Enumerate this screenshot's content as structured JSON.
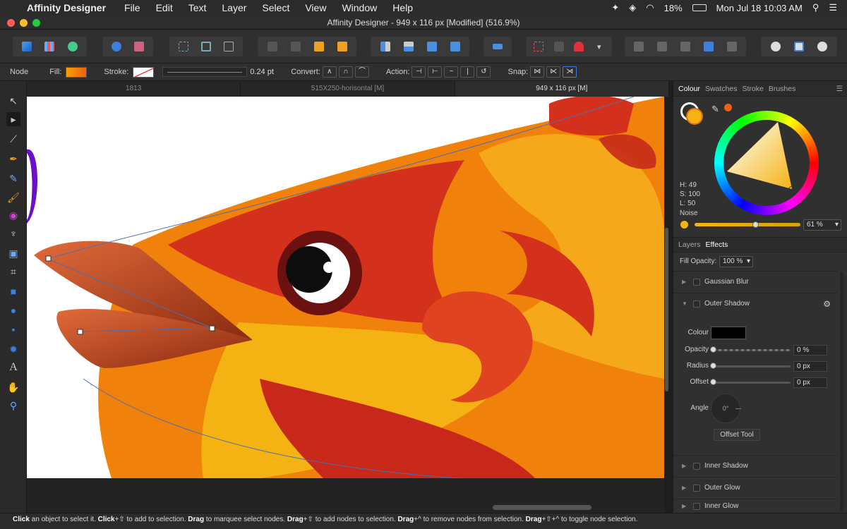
{
  "menubar": {
    "app": "Affinity Designer",
    "items": [
      "File",
      "Edit",
      "Text",
      "Layer",
      "Select",
      "View",
      "Window",
      "Help"
    ],
    "battery": "18%",
    "clock": "Mon Jul 18  10:03 AM"
  },
  "window": {
    "title": "Affinity Designer - 949 x 116 px  [Modified] (516.9%)"
  },
  "context": {
    "mode": "Node",
    "fill_label": "Fill:",
    "stroke_label": "Stroke:",
    "stroke_width": "0.24 pt",
    "convert_label": "Convert:",
    "action_label": "Action:",
    "snap_label": "Snap:"
  },
  "doc_tabs": [
    "1813",
    "515X250-horisontal [M]",
    "949 x 116 px [M]"
  ],
  "colour_panel": {
    "tabs": [
      "Colour",
      "Swatches",
      "Stroke",
      "Brushes"
    ],
    "h": "H: 49",
    "s": "S: 100",
    "l": "L: 50",
    "noise_label": "Noise",
    "noise_value": "61 %"
  },
  "effects_panel": {
    "tabs": [
      "Layers",
      "Effects"
    ],
    "fill_opacity_label": "Fill Opacity:",
    "fill_opacity_value": "100 %",
    "effects": [
      "Gaussian Blur",
      "Outer Shadow",
      "Inner Shadow",
      "Outer Glow",
      "Inner Glow"
    ],
    "outer_shadow": {
      "colour_label": "Colour",
      "opacity_label": "Opacity",
      "opacity_value": "0 %",
      "radius_label": "Radius",
      "radius_value": "0 px",
      "offset_label": "Offset",
      "offset_value": "0 px",
      "angle_label": "Angle",
      "angle_value": "0°",
      "offset_tool": "Offset Tool"
    }
  },
  "status": {
    "parts": [
      [
        "b",
        "Click"
      ],
      " an object to select it. ",
      [
        "b",
        "Click"
      ],
      "+⇧ to add to selection. ",
      [
        "b",
        "Drag"
      ],
      " to marquee select nodes. ",
      [
        "b",
        "Drag"
      ],
      "+⇧ to add nodes to selection. ",
      [
        "b",
        "Drag"
      ],
      "+^ to remove nodes from selection. ",
      [
        "b",
        "Drag"
      ],
      "+⇧+^ to toggle node selection."
    ]
  },
  "colors": {
    "orange": "#f0820c",
    "red": "#d4311c",
    "yellow": "#f5b313",
    "dark_red": "#6b1210",
    "accent_purple": "#6a10c8"
  },
  "icons": [
    "apple-icon",
    "twitter-icon",
    "dropbox-icon",
    "wifi-icon",
    "battery-icon",
    "search-icon",
    "gear-icon",
    "eyedropper-icon"
  ]
}
